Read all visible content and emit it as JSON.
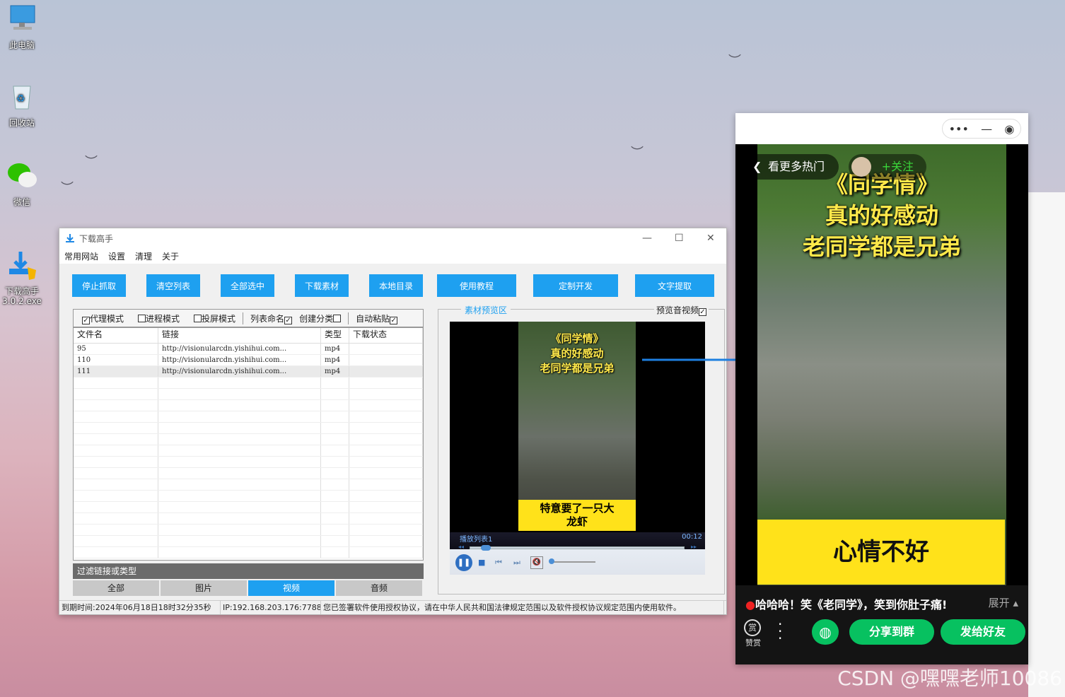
{
  "desktop": {
    "icons": [
      {
        "label": "此电脑",
        "icon": "computer-icon"
      },
      {
        "label": "回收站",
        "icon": "recycle-bin-icon"
      },
      {
        "label": "微信",
        "icon": "wechat-icon"
      },
      {
        "label": "下载高手\n3.0.2.exe",
        "icon": "downloader-icon"
      }
    ],
    "watermark": "CSDN @嘿嘿老师10086"
  },
  "app": {
    "title": "下载高手",
    "menu": [
      "常用网站",
      "设置",
      "清理",
      "关于"
    ],
    "toolbar": [
      "停止抓取",
      "清空列表",
      "全部选中",
      "下载素材",
      "本地目录",
      "使用教程",
      "定制开发",
      "文字提取"
    ],
    "options": [
      {
        "label": "代理模式",
        "checked": true
      },
      {
        "label": "进程模式",
        "checked": false
      },
      {
        "label": "投屏模式",
        "checked": false
      },
      {
        "label": "列表命名",
        "checked": true
      },
      {
        "label": "创建分类",
        "checked": false
      },
      {
        "label": "自动粘贴",
        "checked": true
      }
    ],
    "table": {
      "columns": [
        "文件名",
        "链接",
        "类型",
        "下载状态"
      ],
      "rows": [
        [
          "95",
          "http://visionularcdn.yishihui.com...",
          "mp4",
          ""
        ],
        [
          "110",
          "http://visionularcdn.yishihui.com...",
          "mp4",
          ""
        ],
        [
          "111",
          "http://visionularcdn.yishihui.com...",
          "mp4",
          ""
        ]
      ]
    },
    "filter_label": "过滤链接或类型",
    "type_tabs": [
      "全部",
      "图片",
      "视频",
      "音频"
    ],
    "active_tab": "视频",
    "preview": {
      "label": "素材预览区",
      "toggle_label": "预览音视频",
      "toggle_checked": true,
      "video_caption": "《同学情》\n真的好感动\n老同学都是兄弟",
      "video_subtitle": "特意要了一只大\n龙虾",
      "playlist": "播放列表1",
      "time": "00:12"
    },
    "status": [
      "到期时间:2024年06月18日18时32分35秒",
      "IP:192.168.203.176:7788",
      "您已签署软件使用授权协议，请在中华人民共和国法律规定范围以及软件授权协议规定范围内使用软件。"
    ]
  },
  "mini": {
    "back_label": "看更多热门",
    "follow_label": "+关注",
    "caption": [
      "《同学情》",
      "真的好感动",
      "老同学都是兄弟"
    ],
    "yellow_text": "心情不好",
    "title": "哈哈哈！笑《老同学》，笑到你肚子痛!",
    "expand": "展开",
    "reward": "赞赏",
    "share_group": "分享到群",
    "send_friend": "发给好友"
  },
  "colors": {
    "accent": "#1ea0f0",
    "wechat_green": "#07c160"
  }
}
